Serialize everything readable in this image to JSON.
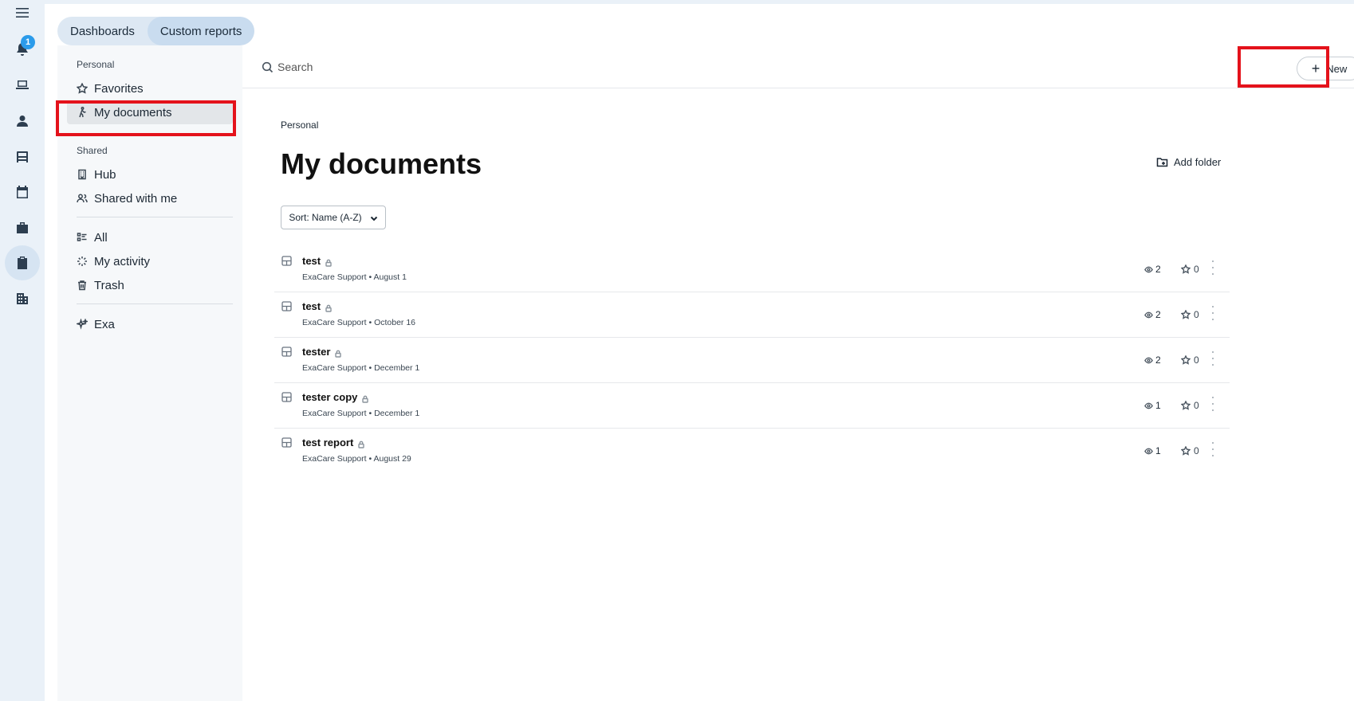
{
  "rail": {
    "notification_count": "1",
    "icons": [
      "menu-icon",
      "bell-icon",
      "laptop-icon",
      "person-icon",
      "bed-icon",
      "calendar-icon",
      "briefcase-icon",
      "clipboard-check-icon",
      "building-icon"
    ]
  },
  "tabs": [
    {
      "label": "Dashboards",
      "active": false
    },
    {
      "label": "Custom reports",
      "active": true
    }
  ],
  "nav": {
    "personal_heading": "Personal",
    "favorites": "Favorites",
    "my_documents": "My documents",
    "shared_heading": "Shared",
    "hub": "Hub",
    "shared_with_me": "Shared with me",
    "all": "All",
    "my_activity": "My activity",
    "trash": "Trash",
    "exa": "Exa"
  },
  "search": {
    "placeholder": "Search"
  },
  "toolbar": {
    "new_label": "New"
  },
  "breadcrumb": "Personal",
  "page_title": "My documents",
  "add_folder_label": "Add folder",
  "sort_label": "Sort: Name (A-Z)",
  "documents": [
    {
      "name": "test",
      "author": "ExaCare Support",
      "date": "August 1",
      "views": "2",
      "stars": "0"
    },
    {
      "name": "test",
      "author": "ExaCare Support",
      "date": "October 16",
      "views": "2",
      "stars": "0"
    },
    {
      "name": "tester",
      "author": "ExaCare Support",
      "date": "December 1",
      "views": "2",
      "stars": "0"
    },
    {
      "name": "tester copy",
      "author": "ExaCare Support",
      "date": "December 1",
      "views": "1",
      "stars": "0"
    },
    {
      "name": "test report",
      "author": "ExaCare Support",
      "date": "August 29",
      "views": "1",
      "stars": "0"
    }
  ],
  "colors": {
    "highlight": "#e4121b",
    "badge": "#2b9bea",
    "rail_bg": "#eaf1f8"
  }
}
